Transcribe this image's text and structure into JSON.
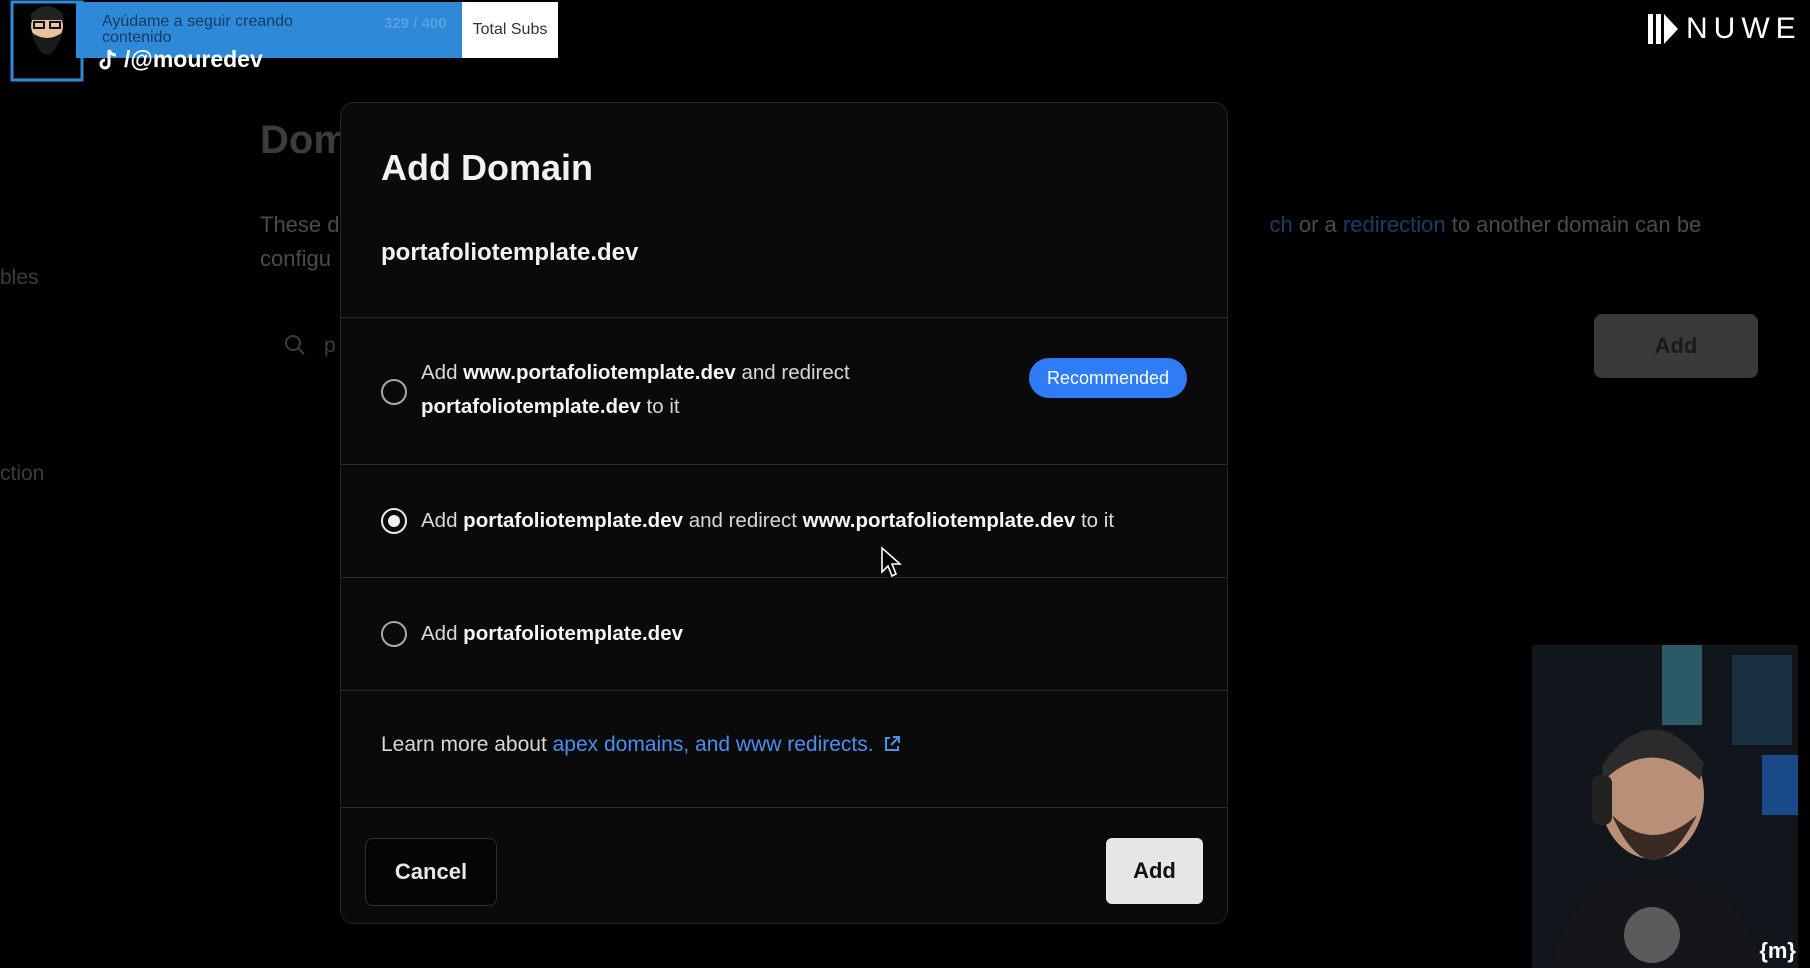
{
  "background": {
    "title": "Dom",
    "description_start": "These d",
    "description_mid_link1": "ch",
    "description_or": " or a ",
    "description_link2": "redirection",
    "description_end": " to another domain can be",
    "description_line2": "configu",
    "sidebar_item1": "bles",
    "sidebar_item2": "ction",
    "search_value": "p",
    "add_label": "Add"
  },
  "stream": {
    "support_text": "Ayúdame a seguir creando contenido",
    "sub_count": "329 / 400",
    "sub_label": "Total Subs",
    "social_handle": "/@mouredev",
    "brand": "NUWE",
    "channel_logo": "{m}"
  },
  "modal": {
    "title": "Add Domain",
    "domain": "portafoliotemplate.dev",
    "options": [
      {
        "prefix": "Add ",
        "bold1": "www.portafoliotemplate.dev",
        "mid": " and redirect",
        "bold2": "portafoliotemplate.dev",
        "suffix": " to it",
        "badge": "Recommended",
        "selected": false
      },
      {
        "prefix": "Add ",
        "bold1": "portafoliotemplate.dev",
        "mid": " and redirect ",
        "bold2": "www.portafoliotemplate.dev",
        "suffix": " to it",
        "selected": true
      },
      {
        "prefix": "Add ",
        "bold1": "portafoliotemplate.dev",
        "selected": false
      }
    ],
    "learn_prefix": "Learn more about ",
    "learn_link": "apex domains, and www redirects.",
    "cancel_label": "Cancel",
    "add_label": "Add"
  },
  "colors": {
    "accent": "#2e7cf6",
    "link": "#4a90f0"
  }
}
